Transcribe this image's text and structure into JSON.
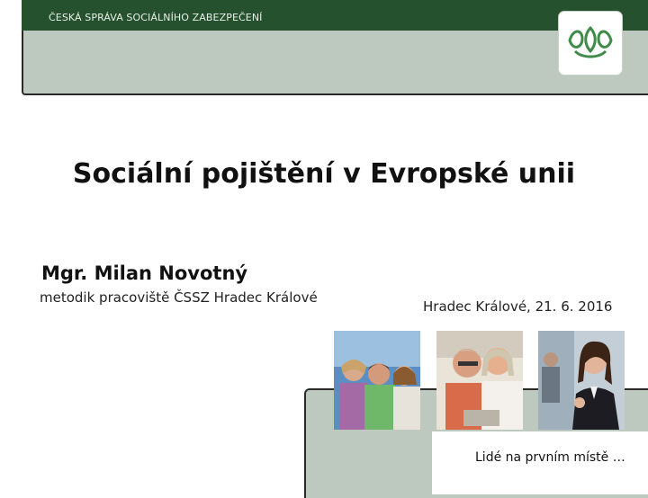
{
  "header": {
    "org_name": "ČESKÁ SPRÁVA SOCIÁLNÍHO ZABEZPEČENÍ",
    "logo_icon": "cssz-leaf-logo-icon"
  },
  "slide": {
    "title": "Sociální pojištění v Evropské unii",
    "author": "Mgr. Milan Novotný",
    "role": "metodik pracoviště ČSSZ Hradec Králové",
    "place_date": "Hradec Králové, 21. 6. 2016"
  },
  "footer": {
    "slogan": "Lidé na prvním místě …"
  },
  "photos": [
    {
      "name": "family-photo"
    },
    {
      "name": "couple-photo"
    },
    {
      "name": "office-woman-photo"
    }
  ],
  "colors": {
    "header_dark_green": "#25512f",
    "band_grey_green": "#bdc9bf",
    "logo_green": "#3e8b4a"
  }
}
